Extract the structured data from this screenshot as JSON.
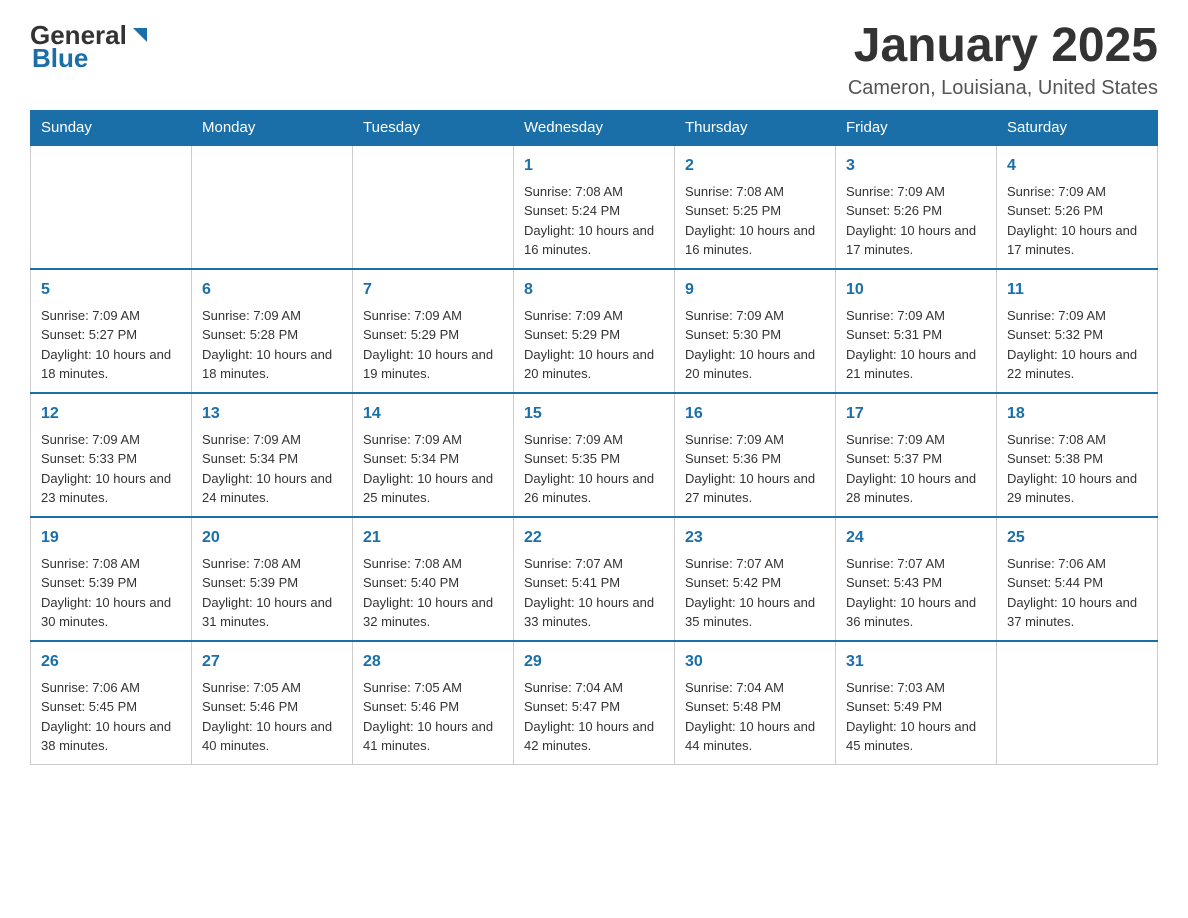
{
  "header": {
    "logo": {
      "general": "General",
      "blue": "Blue"
    },
    "title": "January 2025",
    "subtitle": "Cameron, Louisiana, United States"
  },
  "calendar": {
    "days_of_week": [
      "Sunday",
      "Monday",
      "Tuesday",
      "Wednesday",
      "Thursday",
      "Friday",
      "Saturday"
    ],
    "weeks": [
      [
        {
          "day": "",
          "info": ""
        },
        {
          "day": "",
          "info": ""
        },
        {
          "day": "",
          "info": ""
        },
        {
          "day": "1",
          "info": "Sunrise: 7:08 AM\nSunset: 5:24 PM\nDaylight: 10 hours and 16 minutes."
        },
        {
          "day": "2",
          "info": "Sunrise: 7:08 AM\nSunset: 5:25 PM\nDaylight: 10 hours and 16 minutes."
        },
        {
          "day": "3",
          "info": "Sunrise: 7:09 AM\nSunset: 5:26 PM\nDaylight: 10 hours and 17 minutes."
        },
        {
          "day": "4",
          "info": "Sunrise: 7:09 AM\nSunset: 5:26 PM\nDaylight: 10 hours and 17 minutes."
        }
      ],
      [
        {
          "day": "5",
          "info": "Sunrise: 7:09 AM\nSunset: 5:27 PM\nDaylight: 10 hours and 18 minutes."
        },
        {
          "day": "6",
          "info": "Sunrise: 7:09 AM\nSunset: 5:28 PM\nDaylight: 10 hours and 18 minutes."
        },
        {
          "day": "7",
          "info": "Sunrise: 7:09 AM\nSunset: 5:29 PM\nDaylight: 10 hours and 19 minutes."
        },
        {
          "day": "8",
          "info": "Sunrise: 7:09 AM\nSunset: 5:29 PM\nDaylight: 10 hours and 20 minutes."
        },
        {
          "day": "9",
          "info": "Sunrise: 7:09 AM\nSunset: 5:30 PM\nDaylight: 10 hours and 20 minutes."
        },
        {
          "day": "10",
          "info": "Sunrise: 7:09 AM\nSunset: 5:31 PM\nDaylight: 10 hours and 21 minutes."
        },
        {
          "day": "11",
          "info": "Sunrise: 7:09 AM\nSunset: 5:32 PM\nDaylight: 10 hours and 22 minutes."
        }
      ],
      [
        {
          "day": "12",
          "info": "Sunrise: 7:09 AM\nSunset: 5:33 PM\nDaylight: 10 hours and 23 minutes."
        },
        {
          "day": "13",
          "info": "Sunrise: 7:09 AM\nSunset: 5:34 PM\nDaylight: 10 hours and 24 minutes."
        },
        {
          "day": "14",
          "info": "Sunrise: 7:09 AM\nSunset: 5:34 PM\nDaylight: 10 hours and 25 minutes."
        },
        {
          "day": "15",
          "info": "Sunrise: 7:09 AM\nSunset: 5:35 PM\nDaylight: 10 hours and 26 minutes."
        },
        {
          "day": "16",
          "info": "Sunrise: 7:09 AM\nSunset: 5:36 PM\nDaylight: 10 hours and 27 minutes."
        },
        {
          "day": "17",
          "info": "Sunrise: 7:09 AM\nSunset: 5:37 PM\nDaylight: 10 hours and 28 minutes."
        },
        {
          "day": "18",
          "info": "Sunrise: 7:08 AM\nSunset: 5:38 PM\nDaylight: 10 hours and 29 minutes."
        }
      ],
      [
        {
          "day": "19",
          "info": "Sunrise: 7:08 AM\nSunset: 5:39 PM\nDaylight: 10 hours and 30 minutes."
        },
        {
          "day": "20",
          "info": "Sunrise: 7:08 AM\nSunset: 5:39 PM\nDaylight: 10 hours and 31 minutes."
        },
        {
          "day": "21",
          "info": "Sunrise: 7:08 AM\nSunset: 5:40 PM\nDaylight: 10 hours and 32 minutes."
        },
        {
          "day": "22",
          "info": "Sunrise: 7:07 AM\nSunset: 5:41 PM\nDaylight: 10 hours and 33 minutes."
        },
        {
          "day": "23",
          "info": "Sunrise: 7:07 AM\nSunset: 5:42 PM\nDaylight: 10 hours and 35 minutes."
        },
        {
          "day": "24",
          "info": "Sunrise: 7:07 AM\nSunset: 5:43 PM\nDaylight: 10 hours and 36 minutes."
        },
        {
          "day": "25",
          "info": "Sunrise: 7:06 AM\nSunset: 5:44 PM\nDaylight: 10 hours and 37 minutes."
        }
      ],
      [
        {
          "day": "26",
          "info": "Sunrise: 7:06 AM\nSunset: 5:45 PM\nDaylight: 10 hours and 38 minutes."
        },
        {
          "day": "27",
          "info": "Sunrise: 7:05 AM\nSunset: 5:46 PM\nDaylight: 10 hours and 40 minutes."
        },
        {
          "day": "28",
          "info": "Sunrise: 7:05 AM\nSunset: 5:46 PM\nDaylight: 10 hours and 41 minutes."
        },
        {
          "day": "29",
          "info": "Sunrise: 7:04 AM\nSunset: 5:47 PM\nDaylight: 10 hours and 42 minutes."
        },
        {
          "day": "30",
          "info": "Sunrise: 7:04 AM\nSunset: 5:48 PM\nDaylight: 10 hours and 44 minutes."
        },
        {
          "day": "31",
          "info": "Sunrise: 7:03 AM\nSunset: 5:49 PM\nDaylight: 10 hours and 45 minutes."
        },
        {
          "day": "",
          "info": ""
        }
      ]
    ]
  }
}
